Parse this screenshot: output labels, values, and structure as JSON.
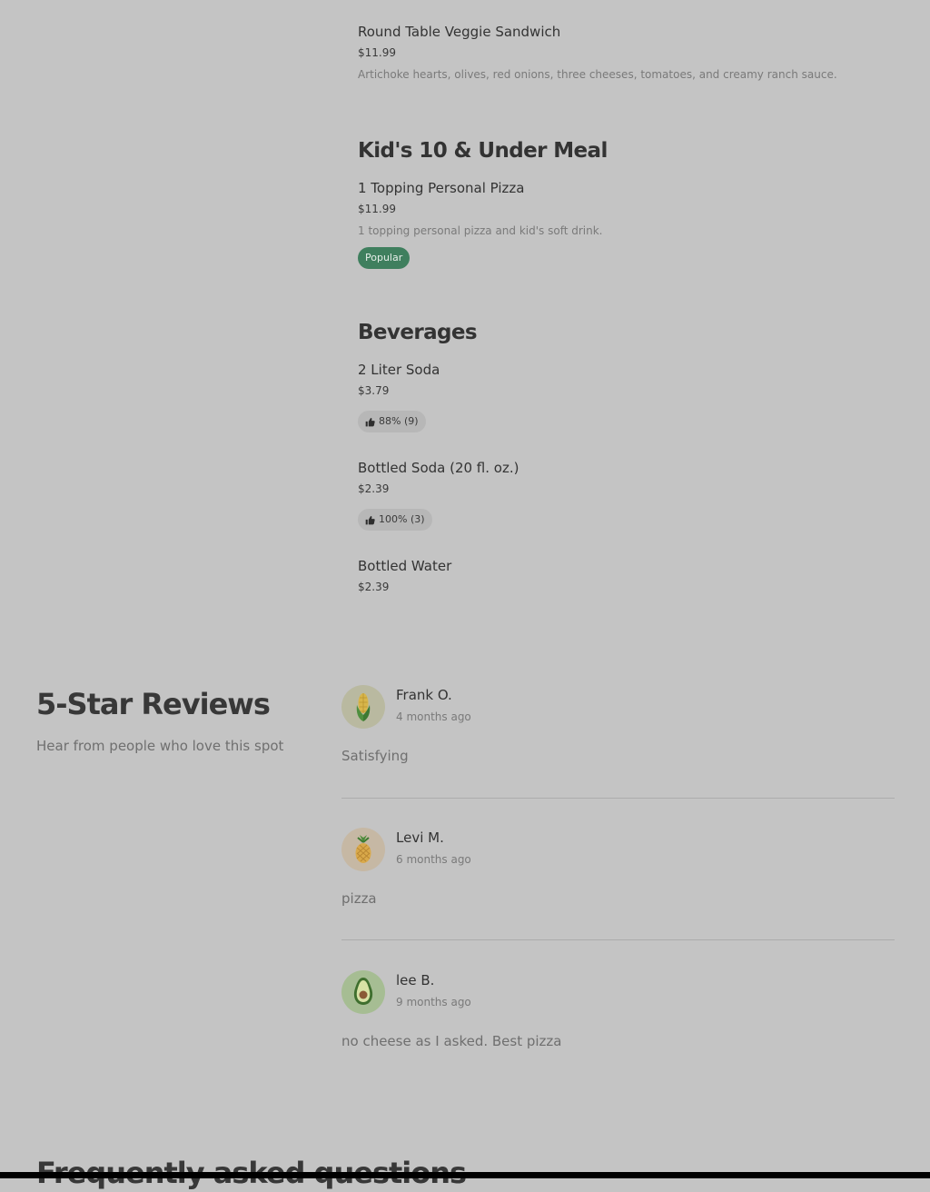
{
  "menu": {
    "veggie_sandwich": {
      "name": "Round Table Veggie Sandwich",
      "price": "$11.99",
      "description": "Artichoke hearts, olives, red onions, three cheeses, tomatoes, and creamy ranch sauce."
    },
    "kids_section": {
      "title": "Kid's 10 & Under Meal",
      "item": {
        "name": "1 Topping Personal Pizza",
        "price": "$11.99",
        "description": "1 topping personal pizza and kid's soft drink.",
        "badge": "Popular"
      }
    },
    "beverages": {
      "title": "Beverages",
      "items": [
        {
          "name": "2 Liter Soda",
          "price": "$3.79",
          "rating": "88% (9)"
        },
        {
          "name": "Bottled Soda (20 fl. oz.)",
          "price": "$2.39",
          "rating": "100% (3)"
        },
        {
          "name": "Bottled Water",
          "price": "$2.39"
        }
      ]
    }
  },
  "reviews": {
    "title": "5-Star Reviews",
    "subtitle": "Hear from people who love this spot",
    "items": [
      {
        "name": "Frank O.",
        "date": "4 months ago",
        "text": "Satisfying",
        "avatar_icon": "corn-icon"
      },
      {
        "name": "Levi M.",
        "date": "6 months ago",
        "text": "pizza",
        "avatar_icon": "pineapple-icon"
      },
      {
        "name": "lee B.",
        "date": "9 months ago",
        "text": "no cheese as I asked. Best pizza",
        "avatar_icon": "avocado-icon"
      }
    ]
  },
  "faq": {
    "title": "Frequently asked questions"
  },
  "colors": {
    "background": "#c4c4c4",
    "popular_badge": "#3f7f5e",
    "rating_pill": "#b7b7b7",
    "bottom_bar": "#000000"
  }
}
